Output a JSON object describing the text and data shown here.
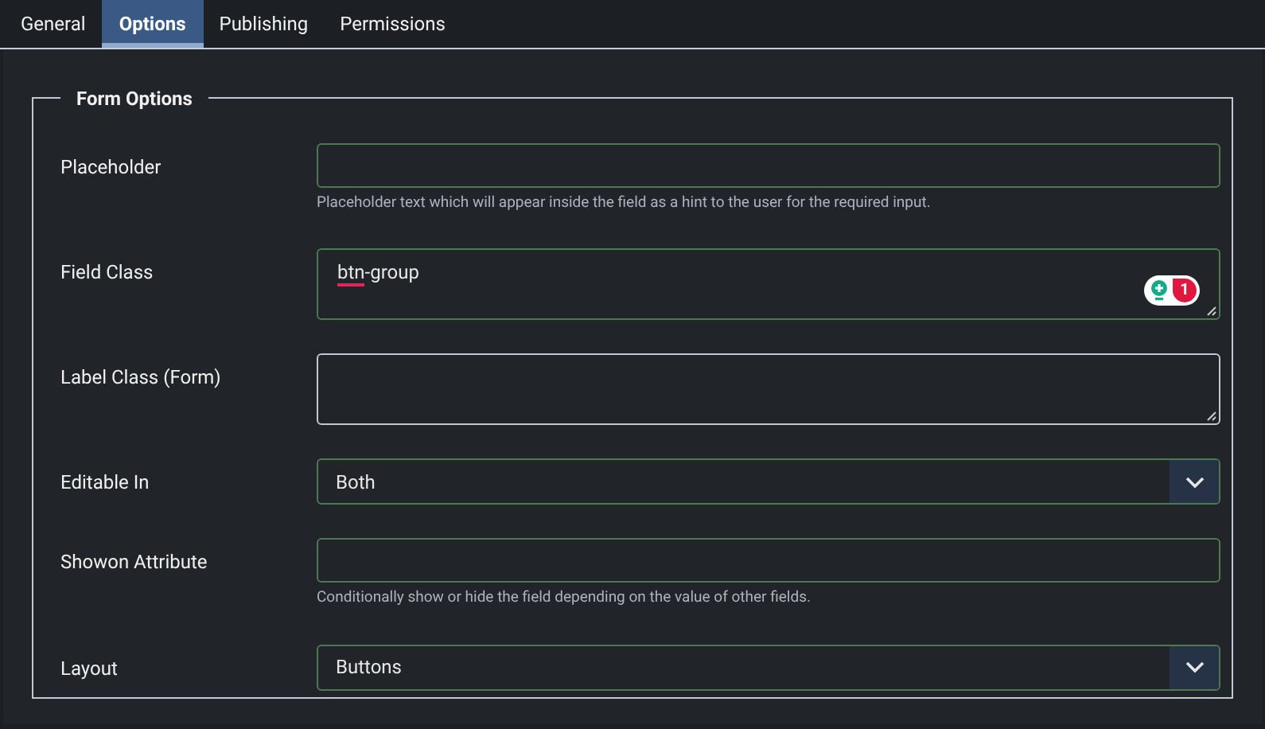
{
  "tabs": [
    {
      "label": "General",
      "selected": false
    },
    {
      "label": "Options",
      "selected": true
    },
    {
      "label": "Publishing",
      "selected": false
    },
    {
      "label": "Permissions",
      "selected": false
    }
  ],
  "fieldset": {
    "legend": "Form Options",
    "fields": [
      {
        "label": "Placeholder",
        "kind": "text",
        "valid": true,
        "help": "Placeholder text which will appear inside the field as a hint to the user for the required input."
      },
      {
        "label": "Field Class",
        "kind": "textarea",
        "valid": true,
        "value": "btn-group",
        "spelling_error": true,
        "badge": {
          "count": "1"
        }
      },
      {
        "label": "Label Class (Form)",
        "kind": "textarea",
        "valid": false
      },
      {
        "label": "Editable In",
        "kind": "select",
        "valid": true,
        "value": "Both"
      },
      {
        "label": "Showon Attribute",
        "kind": "text",
        "valid": true,
        "help": "Conditionally show or hide the field depending on the value of other fields."
      },
      {
        "label": "Layout",
        "kind": "select",
        "valid": true,
        "value": "Buttons"
      }
    ]
  }
}
